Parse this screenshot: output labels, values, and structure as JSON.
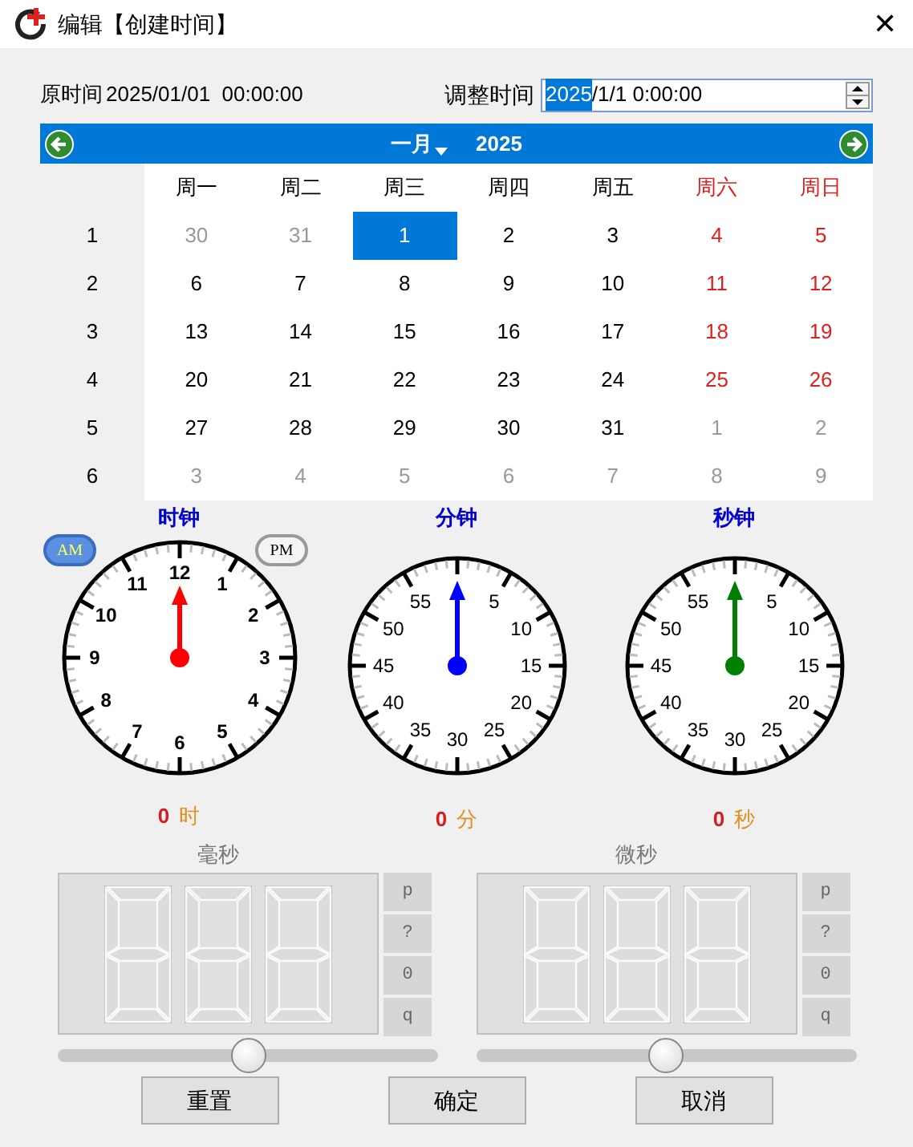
{
  "window": {
    "title": "编辑【创建时间】",
    "close": "✕"
  },
  "original": {
    "label": "原时间",
    "value": "2025/01/01  00:00:00"
  },
  "adjust": {
    "label": "调整时间",
    "selection": "2025",
    "rest": "/1/1 0:00:00"
  },
  "calendar": {
    "month": "一月",
    "year": "2025",
    "weekdays": [
      {
        "label": "周一",
        "weekend": false
      },
      {
        "label": "周二",
        "weekend": false
      },
      {
        "label": "周三",
        "weekend": false
      },
      {
        "label": "周四",
        "weekend": false
      },
      {
        "label": "周五",
        "weekend": false
      },
      {
        "label": "周六",
        "weekend": true
      },
      {
        "label": "周日",
        "weekend": true
      }
    ],
    "weeks": [
      {
        "number": "1",
        "days": [
          {
            "text": "30",
            "muted": true,
            "selected": false
          },
          {
            "text": "31",
            "muted": true,
            "selected": false
          },
          {
            "text": "1",
            "muted": false,
            "selected": true
          },
          {
            "text": "2",
            "muted": false,
            "selected": false
          },
          {
            "text": "3",
            "muted": false,
            "selected": false
          },
          {
            "text": "4",
            "muted": false,
            "selected": false
          },
          {
            "text": "5",
            "muted": false,
            "selected": false
          }
        ]
      },
      {
        "number": "2",
        "days": [
          {
            "text": "6",
            "muted": false,
            "selected": false
          },
          {
            "text": "7",
            "muted": false,
            "selected": false
          },
          {
            "text": "8",
            "muted": false,
            "selected": false
          },
          {
            "text": "9",
            "muted": false,
            "selected": false
          },
          {
            "text": "10",
            "muted": false,
            "selected": false
          },
          {
            "text": "11",
            "muted": false,
            "selected": false
          },
          {
            "text": "12",
            "muted": false,
            "selected": false
          }
        ]
      },
      {
        "number": "3",
        "days": [
          {
            "text": "13",
            "muted": false,
            "selected": false
          },
          {
            "text": "14",
            "muted": false,
            "selected": false
          },
          {
            "text": "15",
            "muted": false,
            "selected": false
          },
          {
            "text": "16",
            "muted": false,
            "selected": false
          },
          {
            "text": "17",
            "muted": false,
            "selected": false
          },
          {
            "text": "18",
            "muted": false,
            "selected": false
          },
          {
            "text": "19",
            "muted": false,
            "selected": false
          }
        ]
      },
      {
        "number": "4",
        "days": [
          {
            "text": "20",
            "muted": false,
            "selected": false
          },
          {
            "text": "21",
            "muted": false,
            "selected": false
          },
          {
            "text": "22",
            "muted": false,
            "selected": false
          },
          {
            "text": "23",
            "muted": false,
            "selected": false
          },
          {
            "text": "24",
            "muted": false,
            "selected": false
          },
          {
            "text": "25",
            "muted": false,
            "selected": false
          },
          {
            "text": "26",
            "muted": false,
            "selected": false
          }
        ]
      },
      {
        "number": "5",
        "days": [
          {
            "text": "27",
            "muted": false,
            "selected": false
          },
          {
            "text": "28",
            "muted": false,
            "selected": false
          },
          {
            "text": "29",
            "muted": false,
            "selected": false
          },
          {
            "text": "30",
            "muted": false,
            "selected": false
          },
          {
            "text": "31",
            "muted": false,
            "selected": false
          },
          {
            "text": "1",
            "muted": true,
            "selected": false
          },
          {
            "text": "2",
            "muted": true,
            "selected": false
          }
        ]
      },
      {
        "number": "6",
        "days": [
          {
            "text": "3",
            "muted": true,
            "selected": false
          },
          {
            "text": "4",
            "muted": true,
            "selected": false
          },
          {
            "text": "5",
            "muted": true,
            "selected": false
          },
          {
            "text": "6",
            "muted": true,
            "selected": false
          },
          {
            "text": "7",
            "muted": true,
            "selected": false
          },
          {
            "text": "8",
            "muted": true,
            "selected": false
          },
          {
            "text": "9",
            "muted": true,
            "selected": false
          }
        ]
      }
    ]
  },
  "meridiem": [
    {
      "label": "AM",
      "selected": true
    },
    {
      "label": "PM",
      "selected": false
    }
  ],
  "clocks": [
    {
      "title": "时钟",
      "kind": "hour",
      "color": "#ff0000",
      "numbers": [
        "12",
        "1",
        "2",
        "3",
        "4",
        "5",
        "6",
        "7",
        "8",
        "9",
        "10",
        "11"
      ],
      "reading": "0",
      "unit": "时"
    },
    {
      "title": "分钟",
      "kind": "minute",
      "color": "#0000ff",
      "numbers": [
        "5",
        "10",
        "15",
        "20",
        "25",
        "30",
        "35",
        "40",
        "45",
        "50",
        "55"
      ],
      "reading": "0",
      "unit": "分"
    },
    {
      "title": "秒钟",
      "kind": "second",
      "color": "#008000",
      "numbers": [
        "5",
        "10",
        "15",
        "20",
        "25",
        "30",
        "35",
        "40",
        "45",
        "50",
        "55"
      ],
      "reading": "0",
      "unit": "秒"
    }
  ],
  "displays": [
    {
      "title": "毫秒",
      "keys": [
        "p",
        "?",
        "0",
        "q"
      ],
      "level": 0.5
    },
    {
      "title": "微秒",
      "keys": [
        "p",
        "?",
        "0",
        "q"
      ],
      "level": 0.5
    }
  ],
  "buttons": [
    "重置",
    "确定",
    "取消"
  ]
}
